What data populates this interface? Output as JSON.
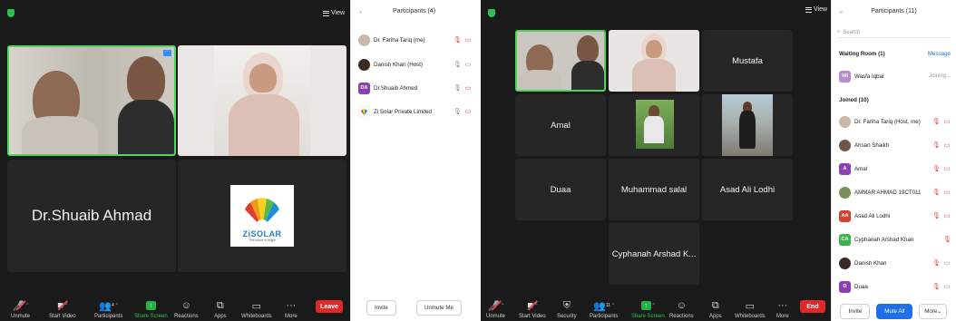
{
  "colors": {
    "accent": "#2d8cff",
    "share_green": "#23b245",
    "leave_red": "#e02828",
    "mic_off_red": "#e0454a",
    "active_border": "#4fd35a"
  },
  "left": {
    "view_label": "View",
    "tiles": {
      "shuaib_name": "Dr.Shuaib Ahmad"
    },
    "logo": {
      "brand": "ZiSOLAR",
      "tagline": "The future is bright"
    },
    "toolbar": {
      "unmute": "Unmute",
      "start_video": "Start Video",
      "participants": "Participants",
      "participants_count": "4",
      "share_screen": "Share Screen",
      "reactions": "Reactions",
      "apps": "Apps",
      "whiteboards": "Whiteboards",
      "more": "More",
      "leave": "Leave"
    },
    "panel": {
      "title": "Participants (4)",
      "participants": [
        {
          "name": "Dr. Fariha Tariq (me)",
          "avatar_text": ""
        },
        {
          "name": "Danish Khan (Host)",
          "avatar_text": ""
        },
        {
          "name": "Dr.Shuaib Ahmed",
          "avatar_text": "DA",
          "avatar_color": "#8b3fb8"
        },
        {
          "name": "Zi Solar Private Limited",
          "avatar_text": ""
        }
      ],
      "invite": "Invite",
      "unmute_me": "Unmute Me"
    }
  },
  "right": {
    "view_label": "View",
    "tiles": {
      "mustafa": "Mustafa",
      "amal": "Amal",
      "duaa": "Duaa",
      "muhammad_salal": "Muhammad salal",
      "asad": "Asad Ali Lodhi",
      "cyphanah": "Cyphanah Arshad K..."
    },
    "toolbar": {
      "unmute": "Unmute",
      "start_video": "Start Video",
      "security": "Security",
      "participants": "Participants",
      "participants_count": "11",
      "share_screen": "Share Screen",
      "reactions": "Reactions",
      "apps": "Apps",
      "whiteboards": "Whiteboards",
      "more": "More",
      "end": "End"
    },
    "panel": {
      "title": "Participants (11)",
      "search_placeholder": "Search",
      "waiting_room": "Waiting Room (1)",
      "message": "Message",
      "waiting": {
        "name": "Wasfa Iqbal",
        "avatar_text": "WI",
        "status": "Joining..."
      },
      "joined": "Joined (10)",
      "participants": [
        {
          "name": "Dr. Fariha Tariq (Host, me)",
          "avatar_text": ""
        },
        {
          "name": "Ahsan Shaikh",
          "avatar_text": ""
        },
        {
          "name": "Amal",
          "avatar_text": "A",
          "avatar_color": "#8b3fb8"
        },
        {
          "name": "AMMAR AHMAD 19CT011",
          "avatar_text": ""
        },
        {
          "name": "Asad Ali Lodhi",
          "avatar_text": "AA",
          "avatar_color": "#d9412f"
        },
        {
          "name": "Cyphanah Arshad Khan",
          "avatar_text": "CA",
          "avatar_color": "#3bb34a"
        },
        {
          "name": "Danish Khan",
          "avatar_text": ""
        },
        {
          "name": "Duaa",
          "avatar_text": "D",
          "avatar_color": "#8b3fb8"
        }
      ],
      "invite": "Invite",
      "mute_all": "Mute All",
      "more": "More"
    }
  }
}
